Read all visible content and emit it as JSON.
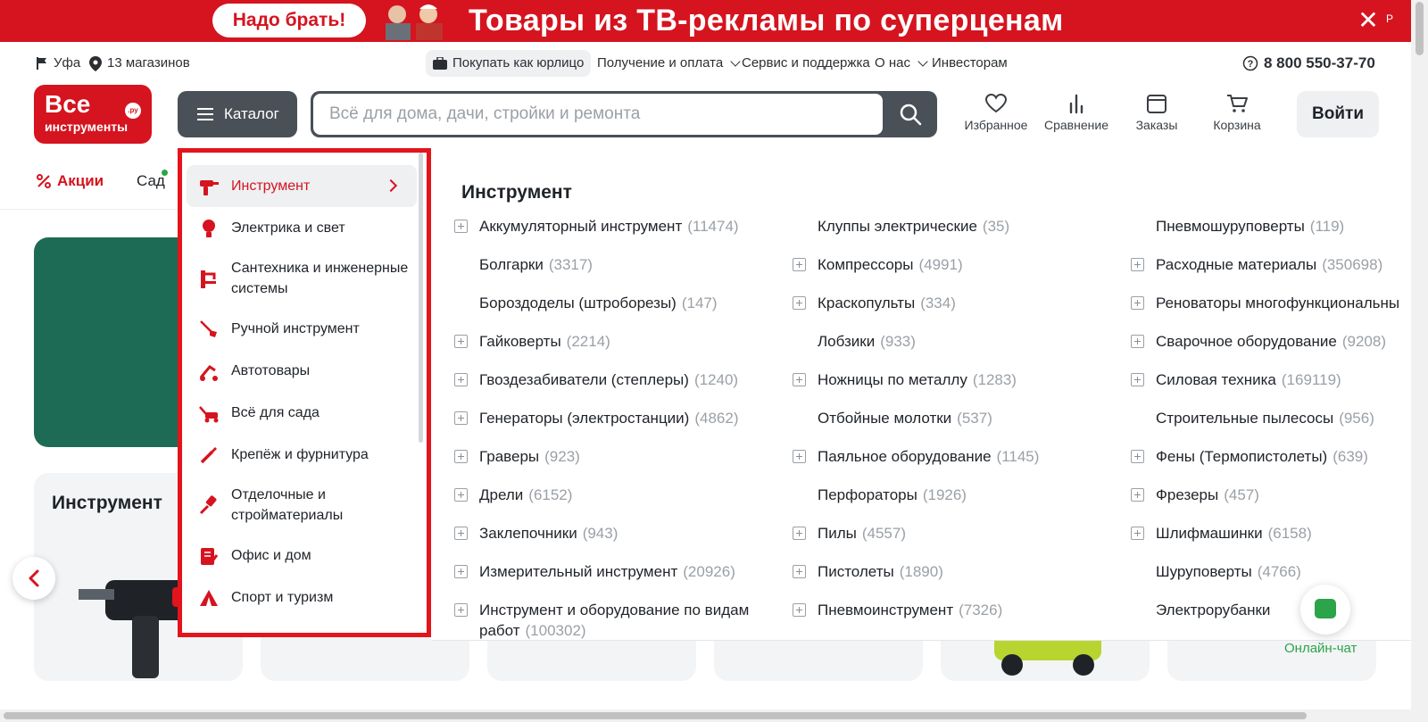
{
  "promo": {
    "badge": "Надо брать!",
    "headline": "Товары из ТВ-рекламы по суперценам",
    "close": "✕",
    "ad_mark": "P"
  },
  "topbar": {
    "city": "Уфа",
    "stores": "13 магазинов",
    "legal": "Покупать как юрлицо",
    "delivery": "Получение и оплата",
    "service": "Сервис и поддержка",
    "about": "О нас",
    "investors": "Инвесторам",
    "phone": "8 800 550-37-70"
  },
  "logo": {
    "line1": "Все",
    "line2": "инструменты",
    "ru": ".ру"
  },
  "header": {
    "catalog_label": "Каталог",
    "search_placeholder": "Всё для дома, дачи, стройки и ремонта",
    "favorites": "Избранное",
    "compare": "Сравнение",
    "orders": "Заказы",
    "cart": "Корзина",
    "login": "Войти"
  },
  "nav": {
    "promo": "Акции",
    "garden": "Сад"
  },
  "background": {
    "card_title": "Инструмент",
    "online_chat": "Онлайн-чат"
  },
  "catalog_menu": {
    "items": [
      {
        "label": "Инструмент",
        "icon": "drill-icon",
        "active": true
      },
      {
        "label": "Электрика и свет",
        "icon": "bulb-icon"
      },
      {
        "label": "Сантехника и инженерные системы",
        "icon": "faucet-icon"
      },
      {
        "label": "Ручной инструмент",
        "icon": "shovel-icon"
      },
      {
        "label": "Автотовары",
        "icon": "car-jack-icon"
      },
      {
        "label": "Всё для сада",
        "icon": "lawnmower-icon"
      },
      {
        "label": "Крепёж и фурнитура",
        "icon": "screw-icon"
      },
      {
        "label": "Отделочные и стройматериалы",
        "icon": "brush-icon"
      },
      {
        "label": "Офис и дом",
        "icon": "office-icon"
      },
      {
        "label": "Спорт и туризм",
        "icon": "tent-icon"
      }
    ]
  },
  "panel": {
    "title": "Инструмент",
    "col1": [
      {
        "name": "Аккумуляторный инструмент",
        "count": "(11474)",
        "expand": true
      },
      {
        "name": "Болгарки",
        "count": "(3317)",
        "expand": false
      },
      {
        "name": "Бороздоделы (штроборезы)",
        "count": "(147)",
        "expand": false
      },
      {
        "name": "Гайковерты",
        "count": "(2214)",
        "expand": true
      },
      {
        "name": "Гвоздезабиватели (степлеры)",
        "count": "(1240)",
        "expand": true
      },
      {
        "name": "Генераторы (электростанции)",
        "count": "(4862)",
        "expand": true
      },
      {
        "name": "Граверы",
        "count": "(923)",
        "expand": true
      },
      {
        "name": "Дрели",
        "count": "(6152)",
        "expand": true
      },
      {
        "name": "Заклепочники",
        "count": "(943)",
        "expand": true
      },
      {
        "name": "Измерительный инструмент",
        "count": "(20926)",
        "expand": true
      },
      {
        "name": "Инструмент и оборудование по видам работ",
        "count": "(100302)",
        "expand": true
      }
    ],
    "col2": [
      {
        "name": "Клуппы электрические",
        "count": "(35)",
        "expand": false
      },
      {
        "name": "Компрессоры",
        "count": "(4991)",
        "expand": true
      },
      {
        "name": "Краскопульты",
        "count": "(334)",
        "expand": true
      },
      {
        "name": "Лобзики",
        "count": "(933)",
        "expand": false
      },
      {
        "name": "Ножницы по металлу",
        "count": "(1283)",
        "expand": true
      },
      {
        "name": "Отбойные молотки",
        "count": "(537)",
        "expand": false
      },
      {
        "name": "Паяльное оборудование",
        "count": "(1145)",
        "expand": true
      },
      {
        "name": "Перфораторы",
        "count": "(1926)",
        "expand": false
      },
      {
        "name": "Пилы",
        "count": "(4557)",
        "expand": true
      },
      {
        "name": "Пистолеты",
        "count": "(1890)",
        "expand": true
      },
      {
        "name": "Пневмоинструмент",
        "count": "(7326)",
        "expand": true
      }
    ],
    "col3": [
      {
        "name": "Пневмошуруповерты",
        "count": "(119)",
        "expand": false
      },
      {
        "name": "Расходные материалы",
        "count": "(350698)",
        "expand": true
      },
      {
        "name": "Реноваторы многофункциональны",
        "count": "",
        "expand": true
      },
      {
        "name": "Сварочное оборудование",
        "count": "(9208)",
        "expand": true
      },
      {
        "name": "Силовая техника",
        "count": "(169119)",
        "expand": true
      },
      {
        "name": "Строительные пылесосы",
        "count": "(956)",
        "expand": false
      },
      {
        "name": "Фены (Термопистолеты)",
        "count": "(639)",
        "expand": true
      },
      {
        "name": "Фрезеры",
        "count": "(457)",
        "expand": true
      },
      {
        "name": "Шлифмашинки",
        "count": "(6158)",
        "expand": true
      },
      {
        "name": "Шуруповерты",
        "count": "(4766)",
        "expand": false
      },
      {
        "name": "Электрорубанки",
        "count": "",
        "expand": false
      }
    ]
  },
  "colors": {
    "brand_red": "#d5141f",
    "dark": "#4a5057",
    "green": "#2ca44a"
  }
}
